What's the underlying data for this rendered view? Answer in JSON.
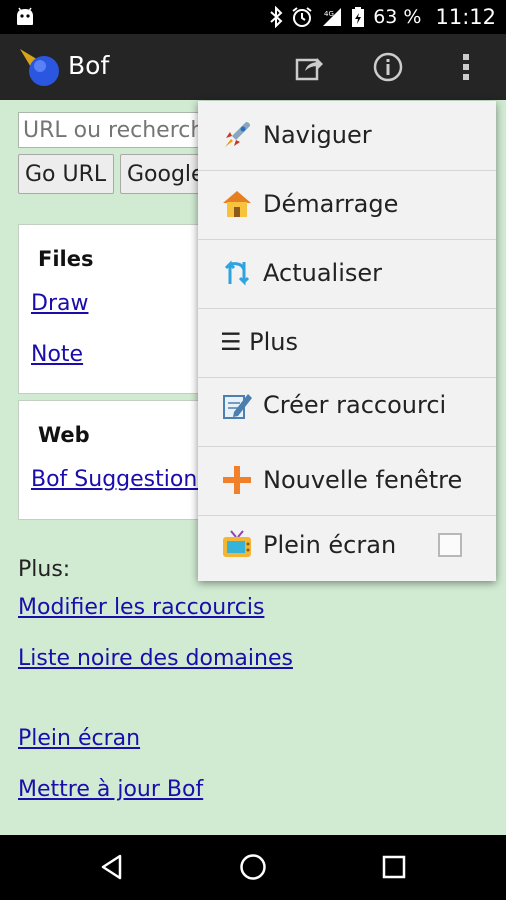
{
  "status_bar": {
    "battery": "63 %",
    "time": "11:12"
  },
  "action_bar": {
    "title": "Bof",
    "icons": [
      "share-icon",
      "info-icon",
      "overflow-menu-icon"
    ]
  },
  "content": {
    "url_placeholder": "URL ou recherche",
    "go_url_label": "Go URL",
    "google_label": "Google",
    "files_card": {
      "title": "Files",
      "links": [
        "Draw",
        "Note"
      ]
    },
    "web_card": {
      "title": "Web",
      "links": [
        "Bof Suggestions"
      ]
    },
    "plus_label": "Plus:",
    "links": [
      "Modifier les raccourcis",
      "Liste noire des domaines",
      "Plein écran",
      "Mettre à jour Bof"
    ]
  },
  "menu": {
    "items": [
      {
        "label": "Naviguer",
        "icon": "rocket-icon"
      },
      {
        "label": "Démarrage",
        "icon": "home-icon"
      },
      {
        "label": "Actualiser",
        "icon": "refresh-icon"
      },
      {
        "label": "☰ Plus",
        "icon": ""
      },
      {
        "label": "Créer raccourci",
        "icon": "pencil-note-icon"
      },
      {
        "label": "Nouvelle fenêtre",
        "icon": "plus-icon"
      },
      {
        "label": "Plein écran",
        "icon": "tv-icon",
        "checked": false
      }
    ]
  },
  "nav_bar": {
    "icons": [
      "back-icon",
      "home-circle-icon",
      "recents-icon"
    ]
  },
  "colors": {
    "background": "#d1ebd3",
    "action_bar": "#252525",
    "link": "#1a0dab",
    "menu_bg": "#f2f2f2"
  }
}
